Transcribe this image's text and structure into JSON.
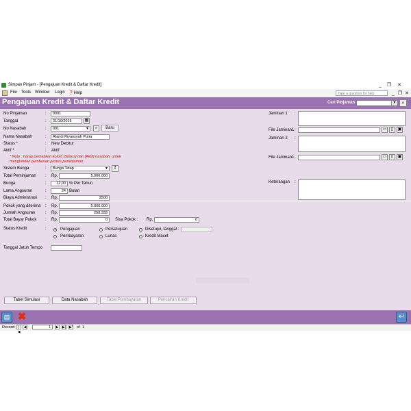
{
  "window": {
    "title": "Simpan Pinjam - [Pengajuan Kredit & Daftar Kredit]",
    "minimize": "_",
    "restore": "❐",
    "close": "✕"
  },
  "menu": {
    "items": [
      "File",
      "Tools",
      "Window",
      "Login",
      "Help"
    ],
    "help_placeholder": "Type a question for help"
  },
  "header": {
    "title": "Pengajuan Kredit & Daftar Kredit",
    "search_label": "Cari Pinjaman :"
  },
  "form": {
    "no_pinjaman": {
      "label": "No Pinjaman",
      "value": "0001"
    },
    "tanggal": {
      "label": "Tanggal",
      "value": "21/10/2016"
    },
    "no_nasabah": {
      "label": "No Nasabah",
      "value": "001",
      "new_button": "Baru"
    },
    "nama_nasabah": {
      "label": "Nama Nasabah",
      "value": "Afandi Riyansyah Putra"
    },
    "status": {
      "label": "Status *",
      "value": "New Debitur"
    },
    "aktif": {
      "label": "Aktif *",
      "value": "Aktif"
    },
    "note_line1": "* Note : harap perhatikan kolom [Status] dan [Aktif] nasabah, untuk",
    "note_line2": "menghindari pemberian proses peminjaman.",
    "sistem_bunga": {
      "label": "Sistem Bunga",
      "value": "Bunga Tetap"
    },
    "total_peminjaman": {
      "label": "Total Peminjaman",
      "currency": "Rp.",
      "value": "5.000.000"
    },
    "bunga": {
      "label": "Bunga",
      "value": "12,00",
      "unit": "% Per Tahun"
    },
    "lama_angsuran": {
      "label": "Lama Angsuran",
      "value": "24",
      "unit": "Bulan"
    },
    "biaya_administrasi": {
      "label": "Biaya Administrasi",
      "currency": "Rp.",
      "value": "2500"
    },
    "pokok_diterima": {
      "label": "Pokok yang diterima",
      "currency": "Rp.",
      "value": "5.000.000"
    },
    "jumlah_angsuran": {
      "label": "Jumlah Angsuran",
      "currency": "Rp.",
      "value": "258.333"
    },
    "total_bayar_pokok": {
      "label": "Total Bayar Pokok",
      "currency": "Rp.",
      "value": "0"
    },
    "sisa_pokok": {
      "label": "Sisa Pokok",
      "currency": "Rp.",
      "value": "0"
    },
    "status_kredit": {
      "label": "Status Kredit",
      "options": [
        "Pengajuan",
        "Persetujuan",
        "Disetujui, tanggal :",
        "Pembayaran",
        "Lunas",
        "Kredit Macet"
      ],
      "selected": "Pengajuan"
    },
    "tanggal_jatuh_tempo": {
      "label": "Tanggal Jatuh Tempo"
    },
    "jaminan1": {
      "label": "Jaminan 1"
    },
    "file_jaminan1_a": {
      "label": "File Jaminan1"
    },
    "jaminan2": {
      "label": "Jaminan 2"
    },
    "file_jaminan1_b": {
      "label": "File Jaminan1"
    },
    "keterangan": {
      "label": "Keterangan"
    }
  },
  "buttons": {
    "tabel_simulasi": "Tabel Simulasi",
    "data_nasabah": "Data Nasabah",
    "tabel_pembayaran": "Tabel Pembayaran",
    "pencairan_kredit": "Pencairan Kredit"
  },
  "navigator": {
    "record_label": "Record:",
    "current": "1",
    "of_label": "of",
    "total": "1"
  },
  "colors": {
    "header_band": "#9b72b0",
    "form_background": "#e8dceb",
    "note_text": "#d01010"
  }
}
